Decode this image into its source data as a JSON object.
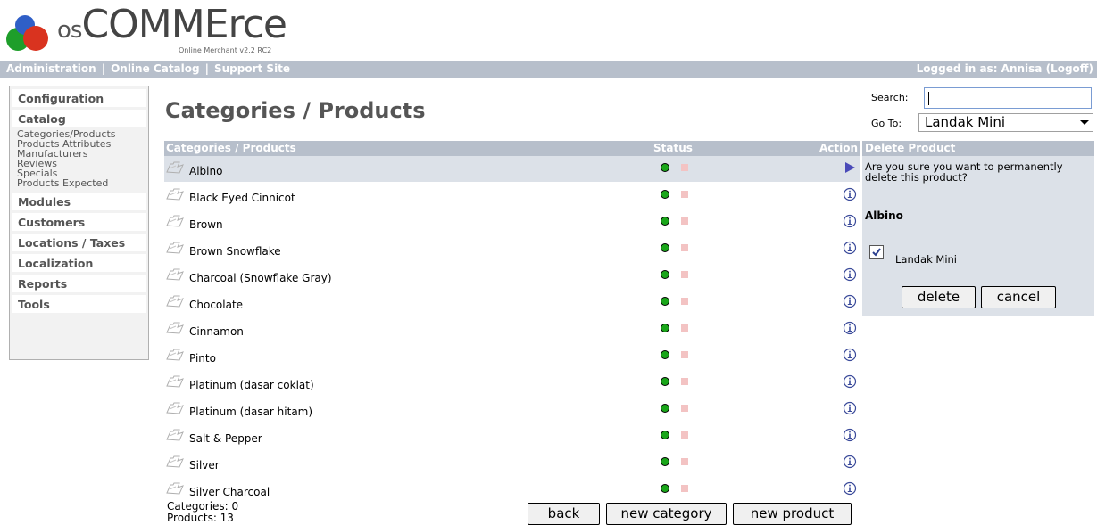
{
  "logo": {
    "brand_prefix": "os",
    "brand_main": "COMMErce",
    "subtitle": "Online Merchant v2.2 RC2"
  },
  "header": {
    "links": [
      "Administration",
      "Online Catalog",
      "Support Site"
    ],
    "separator": "|",
    "logged_in": "Logged in as: Annisa (Logoff)"
  },
  "sidebar": {
    "configuration": "Configuration",
    "catalog": "Catalog",
    "catalog_items": [
      "Categories/Products",
      "Products Attributes",
      "Manufacturers",
      "Reviews",
      "Specials",
      "Products Expected"
    ],
    "modules": "Modules",
    "customers": "Customers",
    "locations": "Locations / Taxes",
    "localization": "Localization",
    "reports": "Reports",
    "tools": "Tools"
  },
  "page_title": "Categories / Products",
  "search": {
    "label": "Search:",
    "value": ""
  },
  "goto": {
    "label": "Go To:",
    "selected": "Landak Mini"
  },
  "table": {
    "headers": {
      "name": "Categories / Products",
      "status": "Status",
      "action": "Action"
    },
    "rows": [
      {
        "name": "Albino",
        "selected": true
      },
      {
        "name": "Black Eyed Cinnicot",
        "selected": false
      },
      {
        "name": "Brown",
        "selected": false
      },
      {
        "name": "Brown Snowflake",
        "selected": false
      },
      {
        "name": "Charcoal (Snowflake Gray)",
        "selected": false
      },
      {
        "name": "Chocolate",
        "selected": false
      },
      {
        "name": "Cinnamon",
        "selected": false
      },
      {
        "name": "Pinto",
        "selected": false
      },
      {
        "name": "Platinum (dasar coklat)",
        "selected": false
      },
      {
        "name": "Platinum (dasar hitam)",
        "selected": false
      },
      {
        "name": "Salt & Pepper",
        "selected": false
      },
      {
        "name": "Silver",
        "selected": false
      },
      {
        "name": "Silver Charcoal",
        "selected": false
      }
    ]
  },
  "counts": {
    "categories": "Categories: 0",
    "products": "Products: 13"
  },
  "buttons": {
    "back": "back",
    "new_category": "new category",
    "new_product": "new product"
  },
  "delete_panel": {
    "title": "Delete Product",
    "message": "Are you sure you want to permanently delete this product?",
    "product_name": "Albino",
    "category_label": "Landak Mini",
    "category_checked": true,
    "delete": "delete",
    "cancel": "cancel"
  },
  "colors": {
    "bar": "#b7bfcb",
    "selected_row": "#dce1e8",
    "status_active": "#1aa61a",
    "status_inactive": "#f3c3c3"
  },
  "icons": {
    "folder": "folder-icon",
    "selected_action": "arrow-right-icon",
    "info_action": "info-icon"
  }
}
